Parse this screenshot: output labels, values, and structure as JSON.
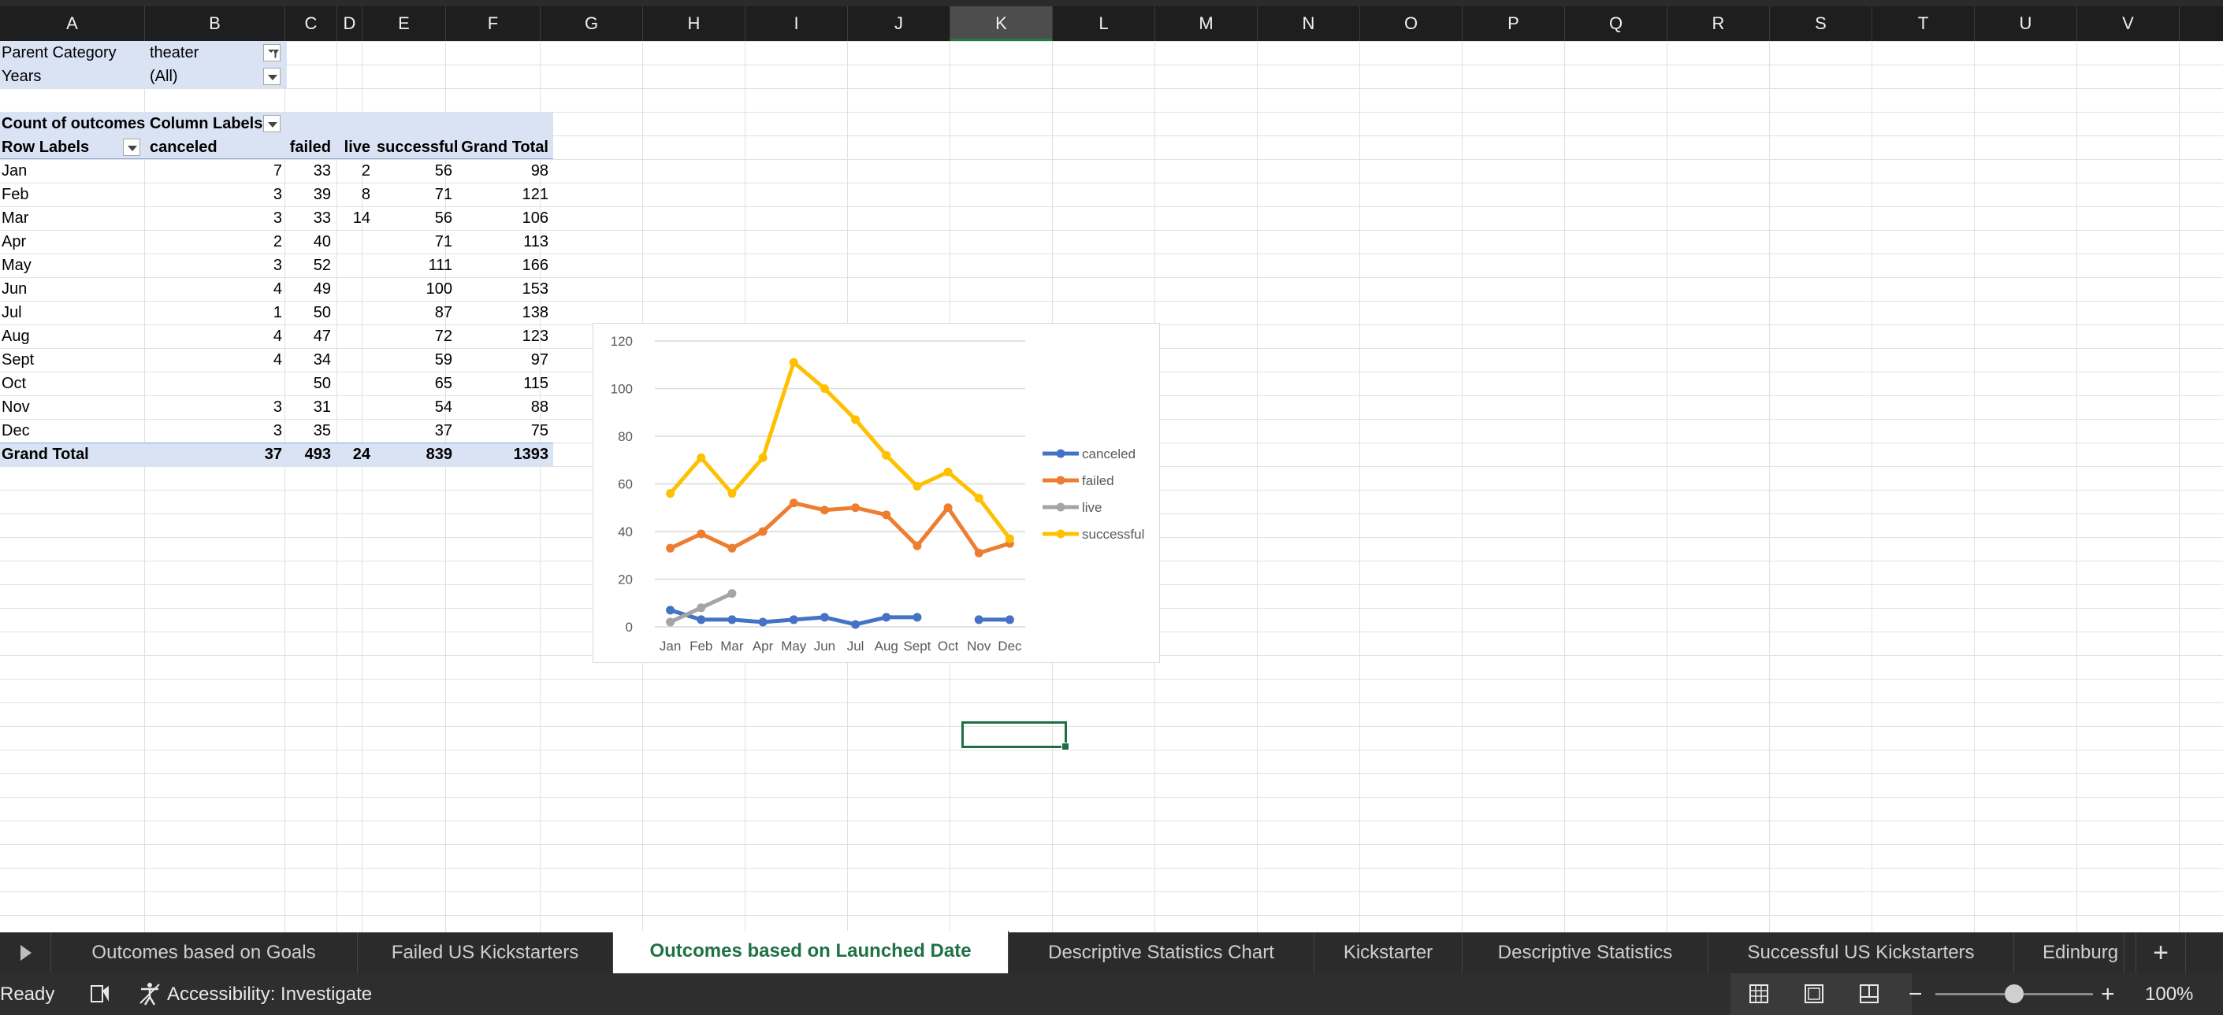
{
  "columns": [
    "A",
    "B",
    "C",
    "D",
    "E",
    "F",
    "G",
    "H",
    "I",
    "J",
    "K",
    "L",
    "M",
    "N",
    "O",
    "P",
    "Q",
    "R",
    "S",
    "T",
    "U",
    "V"
  ],
  "selected_column": "K",
  "filters": [
    {
      "label": "Parent Category",
      "value": "theater"
    },
    {
      "label": "Years",
      "value": "(All)"
    }
  ],
  "pivot": {
    "corner_label": "Count of outcomes",
    "column_labels": "Column Labels",
    "row_labels": "Row Labels",
    "headers": [
      "canceled",
      "failed",
      "live",
      "successful",
      "Grand Total"
    ],
    "rows": [
      {
        "label": "Jan",
        "canceled": "7",
        "failed": "33",
        "live": "2",
        "successful": "56",
        "total": "98"
      },
      {
        "label": "Feb",
        "canceled": "3",
        "failed": "39",
        "live": "8",
        "successful": "71",
        "total": "121"
      },
      {
        "label": "Mar",
        "canceled": "3",
        "failed": "33",
        "live": "14",
        "successful": "56",
        "total": "106"
      },
      {
        "label": "Apr",
        "canceled": "2",
        "failed": "40",
        "live": "",
        "successful": "71",
        "total": "113"
      },
      {
        "label": "May",
        "canceled": "3",
        "failed": "52",
        "live": "",
        "successful": "111",
        "total": "166"
      },
      {
        "label": "Jun",
        "canceled": "4",
        "failed": "49",
        "live": "",
        "successful": "100",
        "total": "153"
      },
      {
        "label": "Jul",
        "canceled": "1",
        "failed": "50",
        "live": "",
        "successful": "87",
        "total": "138"
      },
      {
        "label": "Aug",
        "canceled": "4",
        "failed": "47",
        "live": "",
        "successful": "72",
        "total": "123"
      },
      {
        "label": "Sept",
        "canceled": "4",
        "failed": "34",
        "live": "",
        "successful": "59",
        "total": "97"
      },
      {
        "label": "Oct",
        "canceled": "",
        "failed": "50",
        "live": "",
        "successful": "65",
        "total": "115"
      },
      {
        "label": "Nov",
        "canceled": "3",
        "failed": "31",
        "live": "",
        "successful": "54",
        "total": "88"
      },
      {
        "label": "Dec",
        "canceled": "3",
        "failed": "35",
        "live": "",
        "successful": "37",
        "total": "75"
      }
    ],
    "grand_total": {
      "label": "Grand Total",
      "canceled": "37",
      "failed": "493",
      "live": "24",
      "successful": "839",
      "total": "1393"
    }
  },
  "chart_data": {
    "type": "line",
    "categories": [
      "Jan",
      "Feb",
      "Mar",
      "Apr",
      "May",
      "Jun",
      "Jul",
      "Aug",
      "Sept",
      "Oct",
      "Nov",
      "Dec"
    ],
    "ylim": [
      0,
      120
    ],
    "yticks": [
      "0",
      "20",
      "40",
      "60",
      "80",
      "100",
      "120"
    ],
    "grid": true,
    "legend": "right",
    "series": [
      {
        "name": "canceled",
        "color": "#4472c4",
        "values": [
          7,
          3,
          3,
          2,
          3,
          4,
          1,
          4,
          4,
          null,
          3,
          3
        ]
      },
      {
        "name": "failed",
        "color": "#ed7d31",
        "values": [
          33,
          39,
          33,
          40,
          52,
          49,
          50,
          47,
          34,
          50,
          31,
          35
        ]
      },
      {
        "name": "live",
        "color": "#a5a5a5",
        "values": [
          2,
          8,
          14,
          null,
          null,
          null,
          null,
          null,
          null,
          null,
          null,
          null
        ]
      },
      {
        "name": "successful",
        "color": "#ffc000",
        "values": [
          56,
          71,
          56,
          71,
          111,
          100,
          87,
          72,
          59,
          65,
          54,
          37
        ]
      }
    ]
  },
  "tabs": [
    {
      "label": "Outcomes based on Goals",
      "active": false
    },
    {
      "label": "Failed US Kickstarters",
      "active": false
    },
    {
      "label": "Outcomes based on Launched Date",
      "active": true
    },
    {
      "label": "Descriptive Statistics Chart",
      "active": false
    },
    {
      "label": "Kickstarter",
      "active": false
    },
    {
      "label": "Descriptive Statistics",
      "active": false
    },
    {
      "label": "Successful US Kickstarters",
      "active": false
    },
    {
      "label": "Edinburg",
      "active": false
    }
  ],
  "add_sheet_symbol": "+",
  "status": {
    "ready": "Ready",
    "accessibility": "Accessibility: Investigate",
    "zoom_minus": "−",
    "zoom_plus": "+",
    "zoom_level": "100%",
    "zoom_fraction": 0.5
  },
  "icons": {
    "filter_active": "filter-funnel-icon",
    "dropdown": "chevron-down-icon",
    "tab_scroll": "play-right-icon",
    "macro": "macro-record-icon",
    "accessibility": "accessibility-icon",
    "normal_view": "grid-view-icon",
    "page_layout": "page-layout-icon",
    "page_break": "page-break-icon"
  },
  "colors": {
    "pivot_band": "#dae3f3",
    "active_tab_text": "#1e7145",
    "selection": "#1f6e43"
  }
}
